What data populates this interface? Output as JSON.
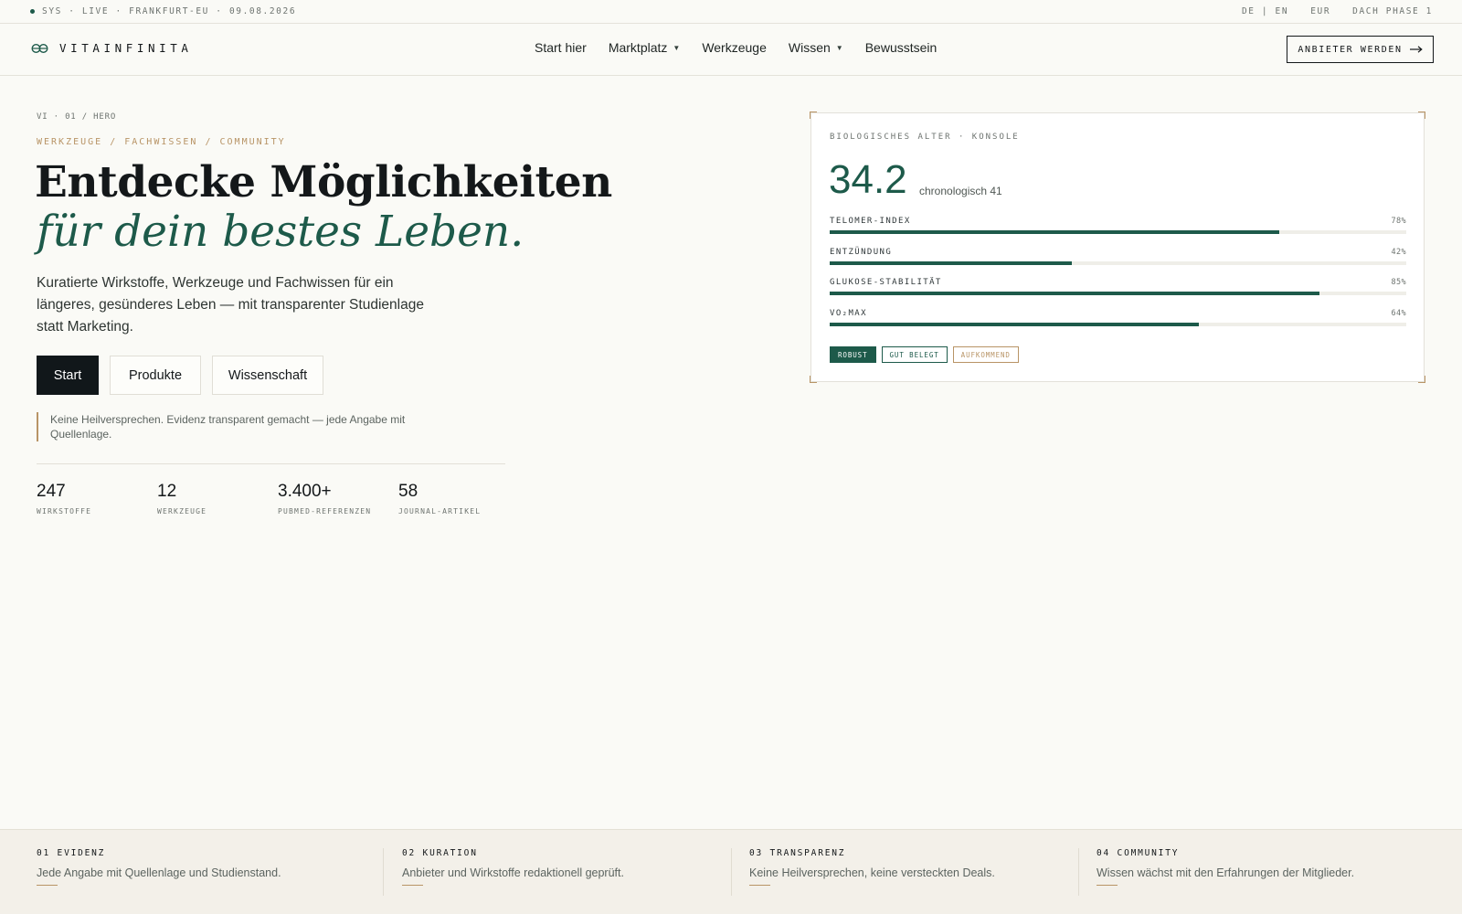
{
  "statusbar": {
    "left": "SYS · LIVE · FRANKFURT-EU · 09.08.2026",
    "lang": "DE | EN",
    "currency": "EUR",
    "phase": "DACH PHASE 1"
  },
  "nav": {
    "brand": "VITAINFINITA",
    "links": [
      "Start hier",
      "Marktplatz",
      "Werkzeuge",
      "Wissen",
      "Bewusstsein"
    ],
    "cta": "ANBIETER WERDEN",
    "cta_icon": "arrow-right-icon"
  },
  "hero": {
    "eyebrow": "VI · 01 / HERO",
    "kicker": "WERKZEUGE / FACHWISSEN / COMMUNITY",
    "title_line1": "Entdecke Möglichkeiten",
    "title_line2": "für dein bestes Leben.",
    "lead": "Kuratierte Wirkstoffe, Werkzeuge und Fachwissen für ein längeres, gesünderes Leben — mit transparenter Studienlage statt Marketing.",
    "buttons": [
      "Start",
      "Produkte",
      "Wissenschaft"
    ],
    "note": "Keine Heilversprechen. Evidenz transparent gemacht — jede Angabe mit Quellenlage.",
    "stats": [
      {
        "value": "247",
        "label": "WIRKSTOFFE"
      },
      {
        "value": "12",
        "label": "WERKZEUGE"
      },
      {
        "value": "3.400+",
        "label": "PUBMED-REFERENZEN"
      },
      {
        "value": "58",
        "label": "JOURNAL-ARTIKEL"
      }
    ]
  },
  "console": {
    "title": "BIOLOGISCHES ALTER · KONSOLE",
    "value": "34.2",
    "chrono": "chronologisch 41",
    "metrics": [
      {
        "label": "TELOMER-INDEX",
        "value": "78%",
        "fraction": 0.78
      },
      {
        "label": "ENTZÜNDUNG",
        "value": "42%",
        "fraction": 0.42
      },
      {
        "label": "GLUKOSE-STABILITÄT",
        "value": "85%",
        "fraction": 0.85
      },
      {
        "label": "VO₂MAX",
        "value": "64%",
        "fraction": 0.64
      }
    ],
    "tags": [
      "ROBUST",
      "GUT BELEGT",
      "AUFKOMMEND"
    ]
  },
  "pillars": [
    {
      "title": "01 EVIDENZ",
      "text": "Jede Angabe mit Quellenlage und Studienstand."
    },
    {
      "title": "02 KURATION",
      "text": "Anbieter und Wirkstoffe redaktionell geprüft."
    },
    {
      "title": "03 TRANSPARENZ",
      "text": "Keine Heilversprechen, keine versteckten Deals."
    },
    {
      "title": "04 COMMUNITY",
      "text": "Wissen wächst mit den Erfahrungen der Mitglieder."
    }
  ],
  "colors": {
    "accent": "#1d5a4a",
    "gold": "#b89466",
    "background": "#fafaf6",
    "ink": "#14181a"
  }
}
